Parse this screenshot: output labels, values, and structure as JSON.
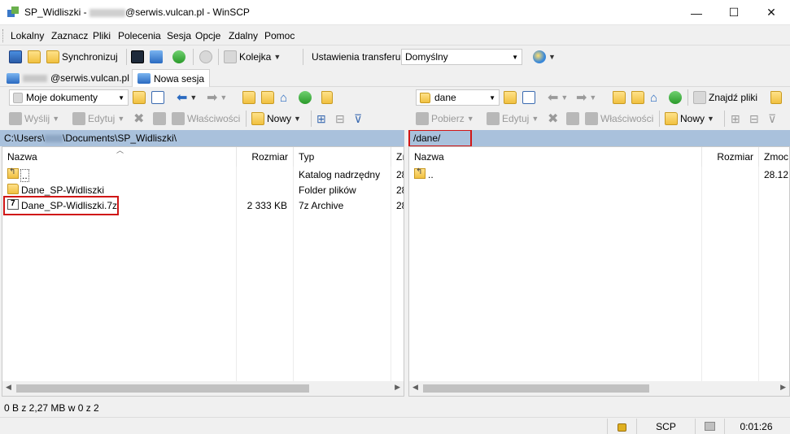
{
  "window": {
    "title_prefix": "SP_Widliszki - ",
    "title_suffix": "@serwis.vulcan.pl - WinSCP",
    "minimize": "—",
    "maximize": "☐",
    "close": "✕"
  },
  "menu": [
    "Lokalny",
    "Zaznacz",
    "Pliki",
    "Polecenia",
    "Sesja",
    "Opcje",
    "Zdalny",
    "Pomoc"
  ],
  "toolbar": {
    "sync_label": "Synchronizuj",
    "queue_label": "Kolejka",
    "transfer_settings_label": "Ustawienia transferu",
    "transfer_preset": "Domyślny"
  },
  "tabs": {
    "session_suffix": "@serwis.vulcan.pl",
    "new_session": "Nowa sesja"
  },
  "left": {
    "location": "Moje dokumenty",
    "send": "Wyślij",
    "edit": "Edytuj",
    "properties": "Właściwości",
    "new": "Nowy",
    "path_prefix": "C:\\Users\\",
    "path_suffix": "\\Documents\\SP_Widliszki\\",
    "columns": {
      "name": "Nazwa",
      "size": "Rozmiar",
      "type": "Typ",
      "changed": "Zı"
    },
    "files": [
      {
        "name": "..",
        "size": "",
        "type": "Katalog nadrzędny",
        "changed": "28",
        "icon": "parent-folder-icon"
      },
      {
        "name": "Dane_SP-Widliszki",
        "size": "",
        "type": "Folder plików",
        "changed": "28",
        "icon": "folder-icon"
      },
      {
        "name": "Dane_SP-Widliszki.7z",
        "size": "2 333 KB",
        "type": "7z Archive",
        "changed": "28",
        "icon": "archive-icon"
      }
    ]
  },
  "right": {
    "location": "dane",
    "download": "Pobierz",
    "edit": "Edytuj",
    "properties": "Właściwości",
    "new": "Nowy",
    "find_files": "Znajdź pliki",
    "path": "/dane/",
    "columns": {
      "name": "Nazwa",
      "size": "Rozmiar",
      "changed": "Zmoc"
    },
    "files": [
      {
        "name": "..",
        "changed": "28.12.",
        "icon": "parent-folder-icon"
      }
    ]
  },
  "status": {
    "selection": "0 B z 2,27 MB w 0 z 2",
    "protocol": "SCP",
    "elapsed": "0:01:26"
  },
  "colors": {
    "path_bar": "#a9c1dc",
    "highlight": "#d01616"
  }
}
